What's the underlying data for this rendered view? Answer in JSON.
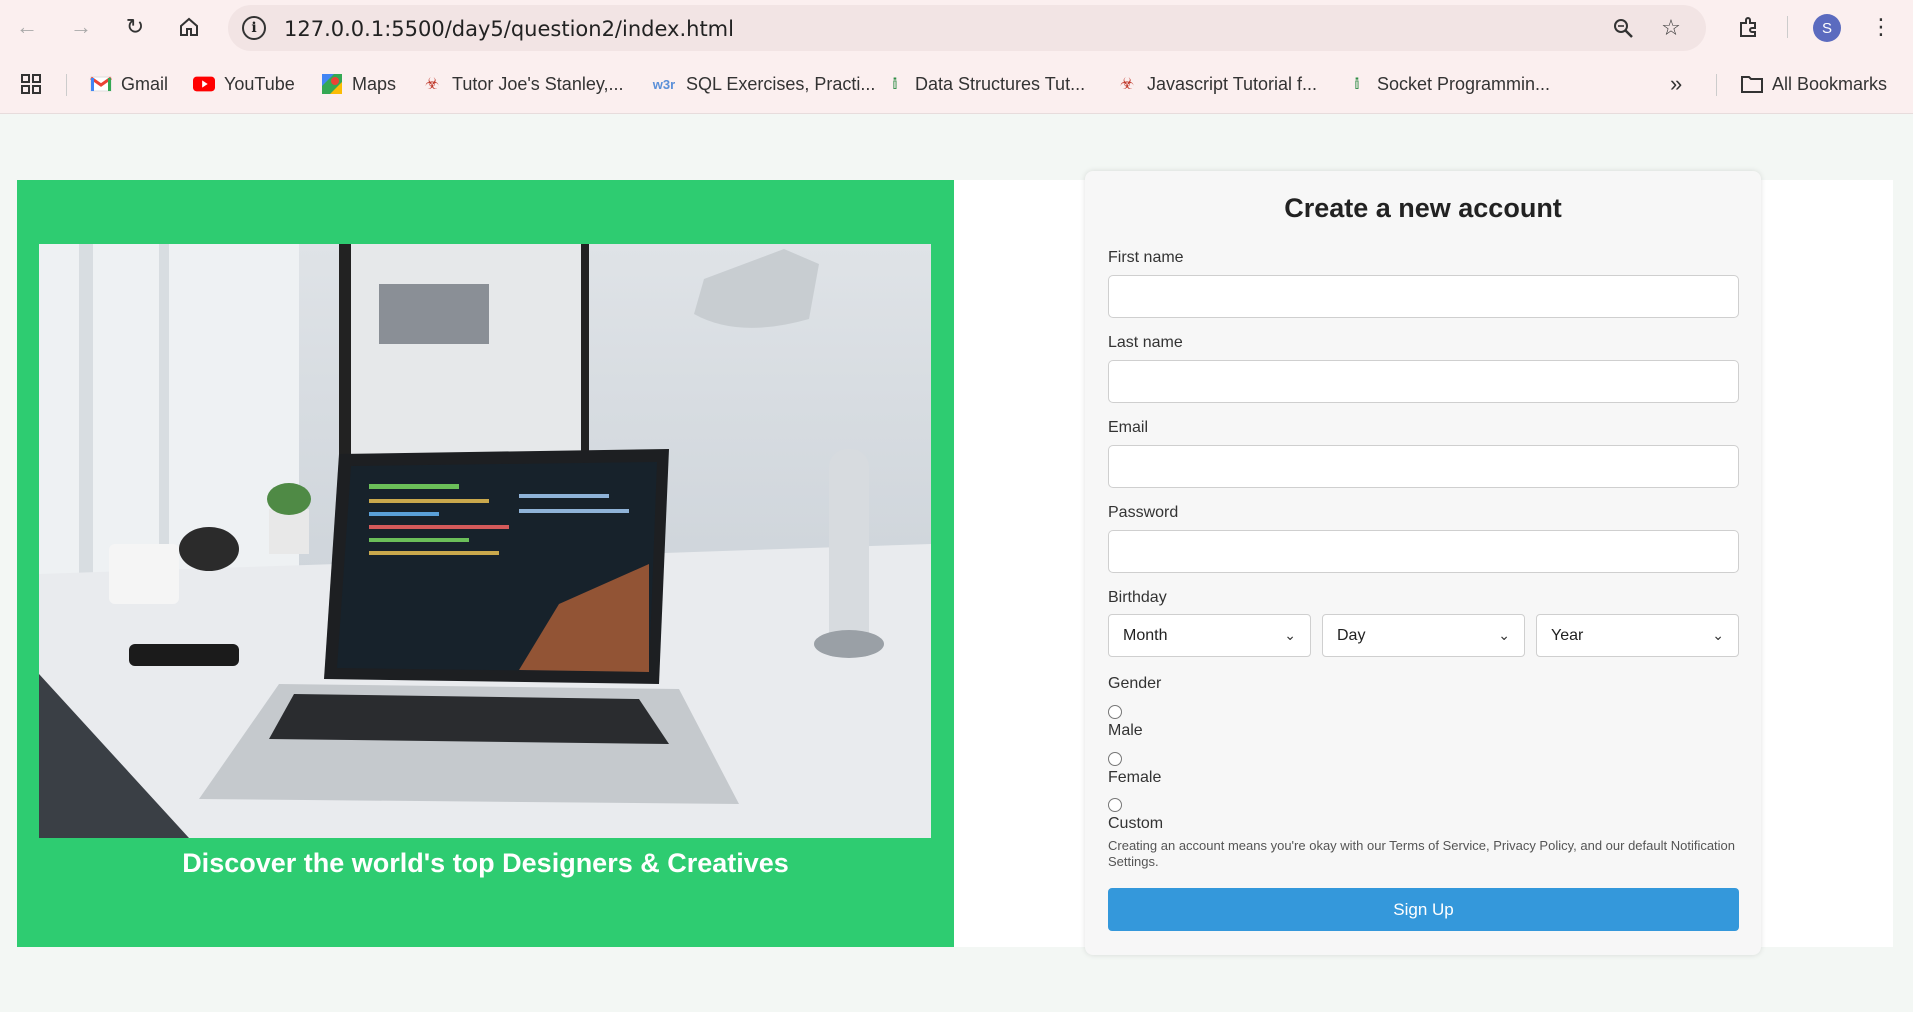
{
  "browser": {
    "url": "127.0.0.1:5500/day5/question2/index.html",
    "profile_initial": "S",
    "accent": "#5b6bbf"
  },
  "bookmarks": [
    {
      "label": "Gmail",
      "icon": "gmail-icon"
    },
    {
      "label": "YouTube",
      "icon": "youtube-icon"
    },
    {
      "label": "Maps",
      "icon": "maps-icon"
    },
    {
      "label": "Tutor Joe's Stanley,...",
      "icon": "tutorjoes-icon"
    },
    {
      "label": "SQL Exercises, Practi...",
      "icon": "w3r-icon"
    },
    {
      "label": "Data Structures Tut...",
      "icon": "gfg-icon"
    },
    {
      "label": "Javascript Tutorial f...",
      "icon": "tutorjoes-icon"
    },
    {
      "label": "Socket Programmin...",
      "icon": "gfg-icon"
    }
  ],
  "all_bookmarks_label": "All Bookmarks",
  "hero": {
    "tagline": "Discover the world's top Designers & Creatives",
    "background": "#2ecc71"
  },
  "form": {
    "title": "Create a new account",
    "first_name_label": "First name",
    "last_name_label": "Last name",
    "email_label": "Email",
    "password_label": "Password",
    "birthday_label": "Birthday",
    "month": "Month",
    "day": "Day",
    "year": "Year",
    "gender_label": "Gender",
    "gender_options": [
      "Male",
      "Female",
      "Custom"
    ],
    "terms": "Creating an account means you're okay with our Terms of Service, Privacy Policy, and our default Notification Settings.",
    "submit": "Sign Up",
    "submit_color": "#3498db"
  }
}
